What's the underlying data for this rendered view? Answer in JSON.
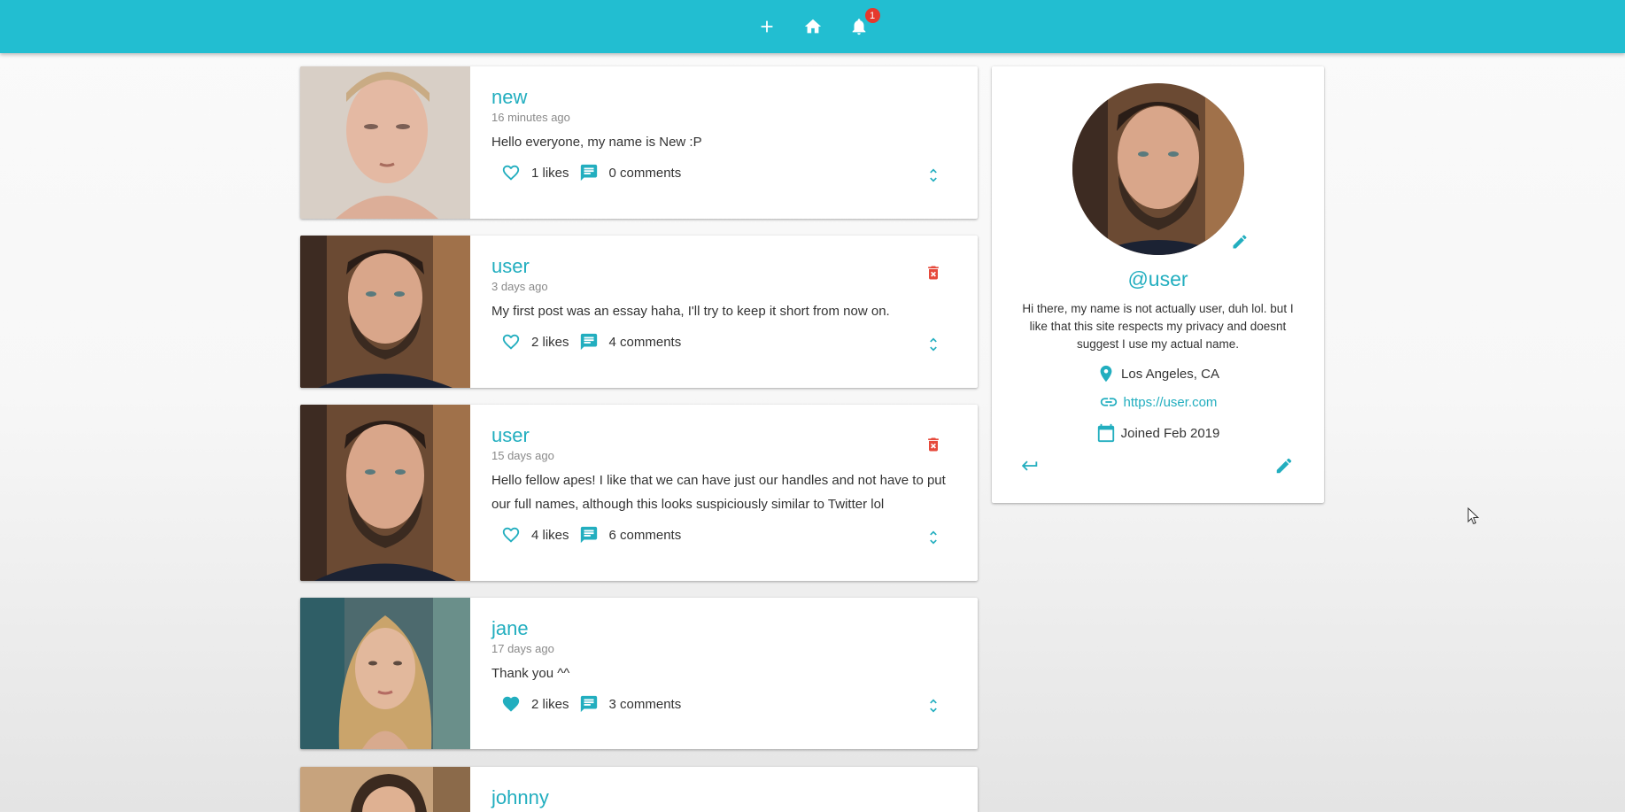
{
  "appbar": {
    "actions": [
      {
        "icon": "plus-icon"
      },
      {
        "icon": "home-icon"
      },
      {
        "icon": "bell-icon",
        "badge": "1"
      }
    ]
  },
  "posts": [
    {
      "handle": "new",
      "time": "16 minutes ago",
      "body": "Hello everyone, my name is New :P",
      "likes": "1 likes",
      "comments": "0 comments",
      "liked": false,
      "deletable": false
    },
    {
      "handle": "user",
      "time": "3 days ago",
      "body": "My first post was an essay haha, I'll try to keep it short from now on.",
      "likes": "2 likes",
      "comments": "4 comments",
      "liked": false,
      "deletable": true
    },
    {
      "handle": "user",
      "time": "15 days ago",
      "body": "Hello fellow apes! I like that we can have just our handles and not have to put our full names, although this looks suspiciously similar to Twitter lol",
      "likes": "4 likes",
      "comments": "6 comments",
      "liked": false,
      "deletable": true
    },
    {
      "handle": "jane",
      "time": "17 days ago",
      "body": "Thank you ^^",
      "likes": "2 likes",
      "comments": "3 comments",
      "liked": true,
      "deletable": false
    },
    {
      "handle": "johnny"
    }
  ],
  "profile": {
    "handle": "@user",
    "bio": "Hi there, my name is not actually user, duh lol. but I like that this site respects my privacy and doesnt suggest I use my actual name.",
    "location": "Los Angeles, CA",
    "website": "https://user.com",
    "joined": "Joined Feb 2019"
  },
  "colors": {
    "primary": "#22bed1",
    "accent_text": "#22aebf",
    "danger": "#e64a3c",
    "badge": "#e5392d"
  }
}
